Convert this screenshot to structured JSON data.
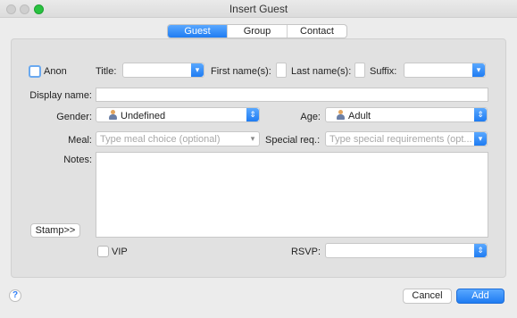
{
  "window": {
    "title": "Insert Guest"
  },
  "tabs": [
    "Guest",
    "Group",
    "Contact"
  ],
  "form": {
    "anon_label": "Anon",
    "title_label": "Title:",
    "first_name_label": "First name(s):",
    "last_name_label": "Last name(s):",
    "suffix_label": "Suffix:",
    "display_name_label": "Display name:",
    "gender_label": "Gender:",
    "gender_value": "Undefined",
    "age_label": "Age:",
    "age_value": "Adult",
    "meal_label": "Meal:",
    "meal_placeholder": "Type meal choice (optional)",
    "special_label": "Special req.:",
    "special_placeholder": "Type special requirements (opt...",
    "notes_label": "Notes:",
    "stamp_label": "Stamp>>",
    "vip_label": "VIP",
    "rsvp_label": "RSVP:"
  },
  "footer": {
    "help": "?",
    "cancel": "Cancel",
    "add": "Add"
  },
  "colors": {
    "accent": "#2f7ef5",
    "traffic_green": "#29c240"
  }
}
